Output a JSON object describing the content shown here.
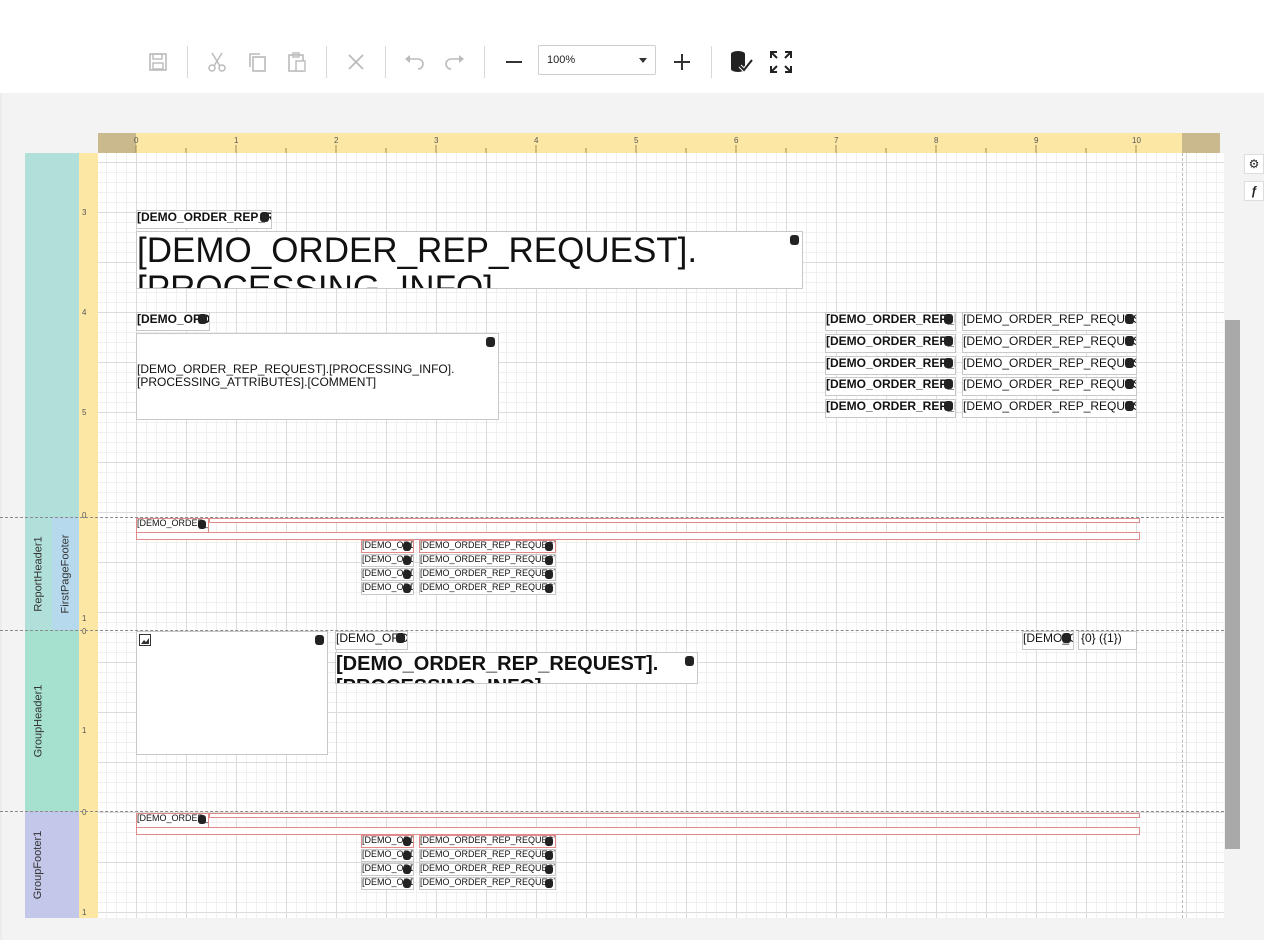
{
  "toolbar": {
    "zoom_value": "100%",
    "icons": [
      "save-icon",
      "cut-icon",
      "copy-icon",
      "paste-icon",
      "delete-icon",
      "undo-icon",
      "redo-icon",
      "zoom-out-icon",
      "zoom-in-icon",
      "validate-bindings-icon",
      "fullscreen-icon"
    ]
  },
  "side_panel": {
    "properties_glyph": "⚙",
    "expressions_glyph": "ƒ"
  },
  "ruler": {
    "top_ticks": [
      "0",
      "1",
      "2",
      "3",
      "4",
      "5",
      "6",
      "7",
      "8",
      "9",
      "10"
    ],
    "left_ticks_header": [
      "3",
      "4",
      "5"
    ],
    "left_ticks_pagefooter": [
      "0",
      "1"
    ],
    "left_ticks_groupheader": [
      "0",
      "1"
    ],
    "left_ticks_groupfooter": [
      "0",
      "1"
    ]
  },
  "bands": {
    "report_header": "ReportHeader1",
    "first_page_footer": "FirstPageFooter",
    "group_header": "GroupHeader1",
    "group_footer": "GroupFooter1"
  },
  "report_header": {
    "small_title": "[DEMO_ORDER_REP_REQUEST]",
    "big_title_line1": "[DEMO_ORDER_REP_REQUEST].",
    "big_title_line2": "[PROCESSING_INFO]",
    "label_left": "[DEMO_ORDER_REP_REQUEST]",
    "comment_line1": "[DEMO_ORDER_REP_REQUEST].[PROCESSING_INFO].",
    "comment_line2": "[PROCESSING_ATTRIBUTES].[COMMENT]",
    "right_labels": [
      "[DEMO_ORDER_REP_REQUEST]",
      "[DEMO_ORDER_REP_REQUEST]",
      "[DEMO_ORDER_REP_REQUEST]",
      "[DEMO_ORDER_REP_REQUEST]",
      "[DEMO_ORDER_REP_REQUEST]"
    ],
    "right_values": [
      "[DEMO_ORDER_REP_REQUEST].[PROCESSING_INFO]",
      "[DEMO_ORDER_REP_REQUEST].[PROCESSING_INFO]",
      "[DEMO_ORDER_REP_REQUEST].[PROCESSING_INFO]",
      "[DEMO_ORDER_REP_REQUEST].[PROCESSING_INFO]",
      "[DEMO_ORDER_REP_REQUEST].[PROCESSING_INFO]"
    ]
  },
  "footer_rows": {
    "head": "[DEMO_ORDER_REP_REQUEST]",
    "col1": [
      "[DEMO_ORDER_REP_REQUEST]",
      "[DEMO_ORDER_REP_REQUEST]",
      "[DEMO_ORDER_REP_REQUEST]",
      "[DEMO_ORDER_REP_REQUEST]"
    ],
    "col2": [
      "[DEMO_ORDER_REP_REQUEST].[FOOTER]",
      "[DEMO_ORDER_REP_REQUEST].[FOOTER]",
      "[DEMO_ORDER_REP_REQUEST].[FOOTER]",
      "[DEMO_ORDER_REP_REQUEST].[FOOTER]"
    ]
  },
  "group_header": {
    "label": "[DEMO_ORDER_REP_REQUEST]",
    "title_line1": "[DEMO_ORDER_REP_REQUEST].",
    "title_line2": "[PROCESSING_INFO]",
    "right_label": "[DEMO_ORDER_REP_REQUEST]",
    "page_info": "{0} ({1})"
  }
}
